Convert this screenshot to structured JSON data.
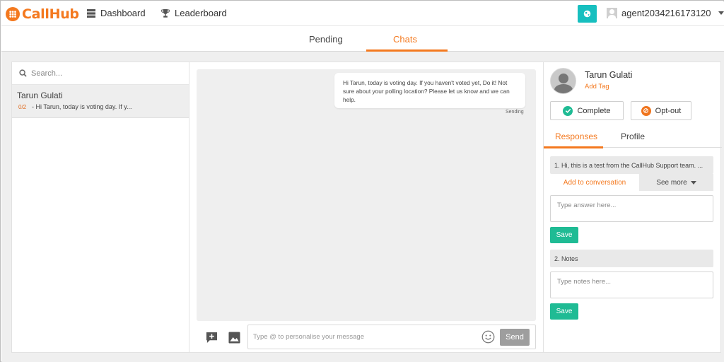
{
  "app": {
    "logo_text": "CallHub",
    "brand_color": "#f4791f"
  },
  "nav": {
    "dashboard_label": "Dashboard",
    "leaderboard_label": "Leaderboard",
    "username": "agent2034216173120"
  },
  "tabs": {
    "pending_label": "Pending",
    "chats_label": "Chats",
    "active": "Chats"
  },
  "sidebar": {
    "search_placeholder": "Search...",
    "conversations": [
      {
        "name": "Tarun Gulati",
        "count": "0/2",
        "preview": "- Hi Tarun, today is voting day. If y..."
      }
    ]
  },
  "chat": {
    "messages": [
      {
        "text": "Hi Tarun, today is voting day. If you haven't voted yet, Do it! Not sure about your polling location? Please let us know and we can help.",
        "status": "Sending"
      }
    ],
    "composer_placeholder": "Type @ to personalise your message",
    "send_label": "Send"
  },
  "contact": {
    "name": "Tarun Gulati",
    "add_tag_label": "Add Tag",
    "complete_label": "Complete",
    "optout_label": "Opt-out",
    "tabs": {
      "responses_label": "Responses",
      "profile_label": "Profile"
    },
    "questions": [
      {
        "title": "1. Hi, this is a test from the CallHub Support team. ...",
        "add_label": "Add to conversation",
        "see_more_label": "See more",
        "input_placeholder": "Type answer here...",
        "save_label": "Save"
      },
      {
        "title": "2. Notes",
        "input_placeholder": "Type notes here...",
        "save_label": "Save"
      }
    ]
  },
  "colors": {
    "accent": "#f4791f",
    "teal": "#17bfbf",
    "save_green": "#1fbb94",
    "complete_green": "#1fbb94"
  }
}
